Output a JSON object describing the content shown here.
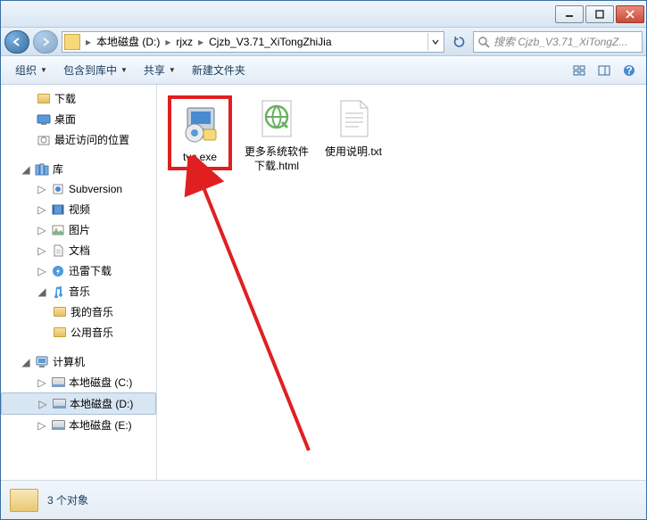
{
  "titlebar": {
    "minimize": "minimize",
    "maximize": "maximize",
    "close": "close"
  },
  "address": {
    "crumbs": [
      "本地磁盘 (D:)",
      "rjxz",
      "Cjzb_V3.71_XiTongZhiJia"
    ]
  },
  "search": {
    "placeholder": "搜索 Cjzb_V3.71_XiTongZ..."
  },
  "toolbar": {
    "organize": "组织",
    "include": "包含到库中",
    "share": "共享",
    "newfolder": "新建文件夹"
  },
  "sidebar": {
    "downloads": "下载",
    "desktop": "桌面",
    "recent": "最近访问的位置",
    "libraries": "库",
    "subversion": "Subversion",
    "videos": "视频",
    "pictures": "图片",
    "documents": "文档",
    "thunder": "迅雷下载",
    "music": "音乐",
    "mymusic": "我的音乐",
    "publicmusic": "公用音乐",
    "computer": "计算机",
    "drive_c": "本地磁盘 (C:)",
    "drive_d": "本地磁盘 (D:)",
    "drive_e": "本地磁盘 (E:)"
  },
  "files": [
    {
      "name": "tvc.exe",
      "type": "exe",
      "highlighted": true
    },
    {
      "name": "更多系统软件下载.html",
      "type": "html",
      "highlighted": false
    },
    {
      "name": "使用说明.txt",
      "type": "txt",
      "highlighted": false
    }
  ],
  "status": {
    "count": "3 个对象"
  }
}
